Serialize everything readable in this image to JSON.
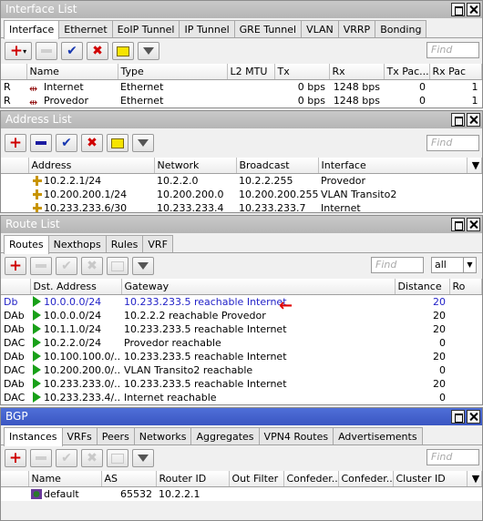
{
  "interface_list": {
    "title": "Interface List",
    "tabs": [
      "Interface",
      "Ethernet",
      "EoIP Tunnel",
      "IP Tunnel",
      "GRE Tunnel",
      "VLAN",
      "VRRP",
      "Bonding"
    ],
    "find_placeholder": "Find",
    "columns": [
      "",
      "Name",
      "Type",
      "L2 MTU",
      "Tx",
      "Rx",
      "Tx Pac...",
      "Rx Pac"
    ],
    "rows": [
      {
        "flag": "R",
        "name": "Internet",
        "type": "Ethernet",
        "l2mtu": "",
        "tx": "0 bps",
        "rx": "1248 bps",
        "txp": "0",
        "rxp": "1"
      },
      {
        "flag": "R",
        "name": "Provedor",
        "type": "Ethernet",
        "l2mtu": "",
        "tx": "0 bps",
        "rx": "1248 bps",
        "txp": "0",
        "rxp": "1"
      }
    ]
  },
  "address_list": {
    "title": "Address List",
    "find_placeholder": "Find",
    "columns": [
      "Address",
      "Network",
      "Broadcast",
      "Interface"
    ],
    "rows": [
      {
        "address": "10.2.2.1/24",
        "network": "10.2.2.0",
        "broadcast": "10.2.2.255",
        "interface": "Provedor"
      },
      {
        "address": "10.200.200.1/24",
        "network": "10.200.200.0",
        "broadcast": "10.200.200.255",
        "interface": "VLAN Transito2"
      },
      {
        "address": "10.233.233.6/30",
        "network": "10.233.233.4",
        "broadcast": "10.233.233.7",
        "interface": "Internet"
      }
    ]
  },
  "route_list": {
    "title": "Route List",
    "tabs": [
      "Routes",
      "Nexthops",
      "Rules",
      "VRF"
    ],
    "find_placeholder": "Find",
    "filter_value": "all",
    "columns": [
      "",
      "Dst. Address",
      "Gateway",
      "Distance",
      "Ro"
    ],
    "rows": [
      {
        "flag": "Db",
        "dst": "10.0.0.0/24",
        "gateway": "10.233.233.5 reachable Internet",
        "distance": "20",
        "highlight": true
      },
      {
        "flag": "DAb",
        "dst": "10.0.0.0/24",
        "gateway": "10.2.2.2 reachable Provedor",
        "distance": "20",
        "highlight": false
      },
      {
        "flag": "DAb",
        "dst": "10.1.1.0/24",
        "gateway": "10.233.233.5 reachable Internet",
        "distance": "20",
        "highlight": false
      },
      {
        "flag": "DAC",
        "dst": "10.2.2.0/24",
        "gateway": "Provedor reachable",
        "distance": "0",
        "highlight": false
      },
      {
        "flag": "DAb",
        "dst": "10.100.100.0/...",
        "gateway": "10.233.233.5 reachable Internet",
        "distance": "20",
        "highlight": false
      },
      {
        "flag": "DAC",
        "dst": "10.200.200.0/...",
        "gateway": "VLAN Transito2 reachable",
        "distance": "0",
        "highlight": false
      },
      {
        "flag": "DAb",
        "dst": "10.233.233.0/...",
        "gateway": "10.233.233.5 reachable Internet",
        "distance": "20",
        "highlight": false
      },
      {
        "flag": "DAC",
        "dst": "10.233.233.4/...",
        "gateway": "Internet reachable",
        "distance": "0",
        "highlight": false
      }
    ]
  },
  "bgp": {
    "title": "BGP",
    "tabs": [
      "Instances",
      "VRFs",
      "Peers",
      "Networks",
      "Aggregates",
      "VPN4 Routes",
      "Advertisements"
    ],
    "find_placeholder": "Find",
    "columns": [
      "Name",
      "AS",
      "Router ID",
      "Out Filter",
      "Confeder...",
      "Confeder...",
      "Cluster ID"
    ],
    "rows": [
      {
        "name": "default",
        "as": "65532",
        "router_id": "10.2.2.1",
        "out_filter": "",
        "conf1": "",
        "conf2": "",
        "cluster": ""
      }
    ]
  },
  "colors": {
    "active_title": "#3a56c2",
    "inactive_title": "#bdbdbd",
    "highlight_row": "#2323c8",
    "annotation": "#e00000"
  }
}
